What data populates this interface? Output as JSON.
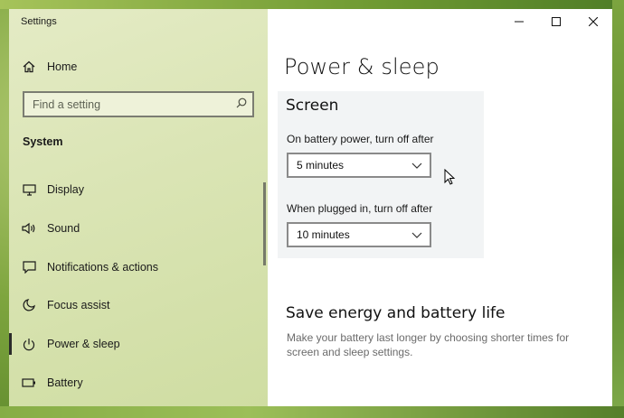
{
  "window": {
    "app_title": "Settings",
    "caption": {
      "minimize_icon": "minimize-icon",
      "maximize_icon": "maximize-icon",
      "close_icon": "close-icon"
    }
  },
  "sidebar": {
    "home": {
      "label": "Home",
      "icon": "home-icon"
    },
    "search": {
      "placeholder": "Find a setting",
      "value": "",
      "icon": "search-icon"
    },
    "section_header": "System",
    "items": [
      {
        "label": "Display",
        "icon": "display-icon",
        "selected": false
      },
      {
        "label": "Sound",
        "icon": "speaker-icon",
        "selected": false
      },
      {
        "label": "Notifications & actions",
        "icon": "notification-icon",
        "selected": false
      },
      {
        "label": "Focus assist",
        "icon": "moon-icon",
        "selected": false
      },
      {
        "label": "Power & sleep",
        "icon": "power-icon",
        "selected": true
      },
      {
        "label": "Battery",
        "icon": "battery-icon",
        "selected": false
      }
    ]
  },
  "main": {
    "page_title": "Power & sleep",
    "screen": {
      "heading": "Screen",
      "battery": {
        "label": "On battery power, turn off after",
        "value": "5 minutes"
      },
      "plugged_in": {
        "label": "When plugged in, turn off after",
        "value": "10 minutes"
      }
    },
    "save_energy": {
      "heading": "Save energy and battery life",
      "description": "Make your battery last longer by choosing shorter times for screen and sleep settings."
    }
  },
  "colors": {
    "sidebar_bg": "#dbe5b6",
    "selected_indicator": "#2b2b2b",
    "panel_bg": "#f2f4f5",
    "desc_text": "#6b6b6b"
  }
}
